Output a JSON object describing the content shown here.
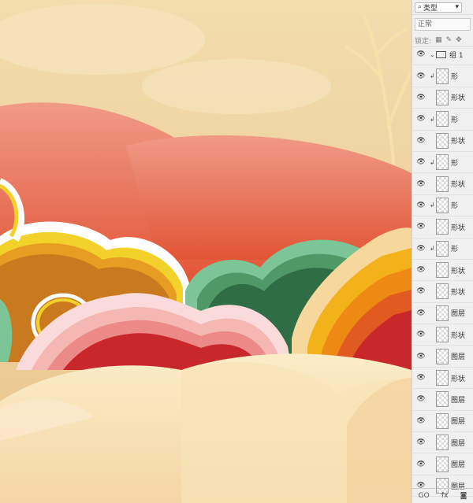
{
  "canvas": {
    "colors": {
      "sky": "#f0d29e",
      "red_hill": "#ec8a78",
      "orange_cloud": "#c97a1e",
      "yellow_ring": "#f2d12a",
      "green_cloud": "#2f6d45",
      "light_green": "#7bc596",
      "pink_cloud": "#f4b7b2",
      "red_cloud": "#c8282b",
      "cream_cloud": "#f8e2b8"
    }
  },
  "panel": {
    "filter_label": "类型",
    "blend_mode": "正常",
    "lock_label": "锁定:",
    "group_name": "组 1",
    "layers": [
      {
        "name": "形",
        "clip": true
      },
      {
        "name": "形状",
        "clip": false
      },
      {
        "name": "形",
        "clip": true
      },
      {
        "name": "形状",
        "clip": false
      },
      {
        "name": "形",
        "clip": true
      },
      {
        "name": "形状",
        "clip": false
      },
      {
        "name": "形",
        "clip": true
      },
      {
        "name": "形状",
        "clip": false
      },
      {
        "name": "形",
        "clip": true
      },
      {
        "name": "形状",
        "clip": false
      },
      {
        "name": "形状",
        "clip": false
      },
      {
        "name": "图层",
        "clip": false
      },
      {
        "name": "形状",
        "clip": false
      },
      {
        "name": "图层",
        "clip": false
      },
      {
        "name": "形状",
        "clip": false
      },
      {
        "name": "图层",
        "clip": false
      },
      {
        "name": "图层",
        "clip": false
      },
      {
        "name": "图层",
        "clip": false
      },
      {
        "name": "图层",
        "clip": false
      },
      {
        "name": "图层",
        "clip": false
      }
    ],
    "footer": {
      "link": "GO",
      "fx": "fx"
    }
  }
}
